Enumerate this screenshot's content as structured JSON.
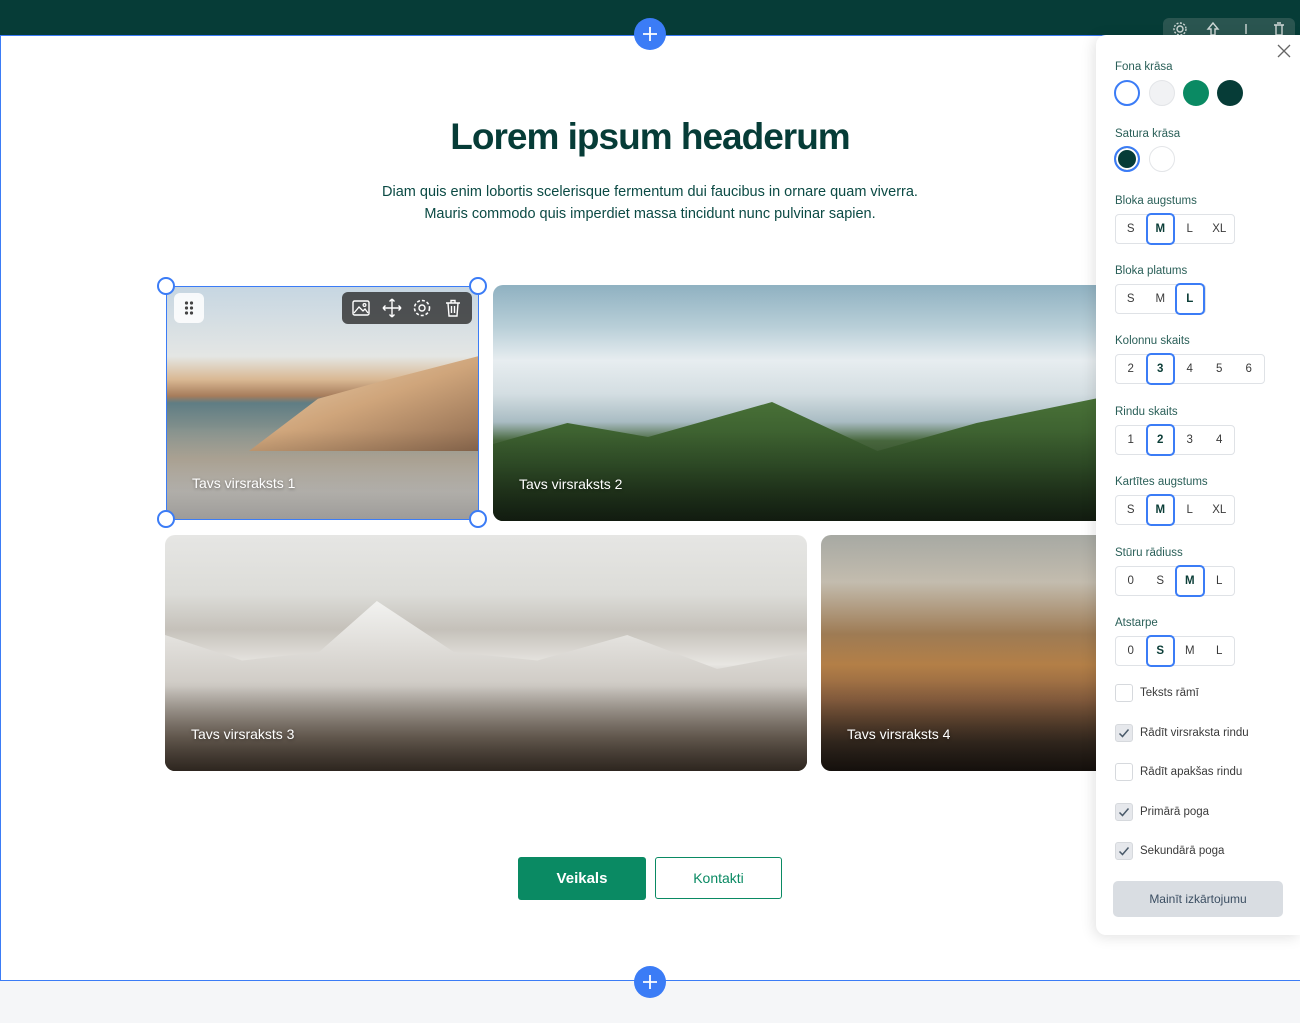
{
  "section": {
    "headline": "Lorem ipsum headerum",
    "lead_line1": "Diam quis enim lobortis scelerisque fermentum dui faucibus in ornare quam viverra.",
    "lead_line2": "Mauris commodo quis imperdiet massa tincidunt nunc pulvinar sapien."
  },
  "cards": [
    {
      "title": "Tavs virsraksts 1"
    },
    {
      "title": "Tavs virsraksts 2"
    },
    {
      "title": "Tavs virsraksts 3"
    },
    {
      "title": "Tavs virsraksts 4"
    }
  ],
  "buttons": {
    "primary": "Veikals",
    "secondary": "Kontakti"
  },
  "icons": {
    "add": "plus-icon",
    "drag": "drag-dots-icon",
    "image": "image-icon",
    "move": "move-icon",
    "settings": "gear-icon",
    "delete": "trash-icon",
    "close": "close-icon",
    "check": "check-icon"
  },
  "colors": {
    "accent": "#3b7cf6",
    "brand_dark": "#063c37",
    "brand_green": "#0a8a63"
  },
  "panel": {
    "bg_color_label": "Fona krāsa",
    "bg_colors": [
      "#ffffff",
      "#f1f2f4",
      "#0a8a63",
      "#063c37"
    ],
    "bg_selected": 0,
    "content_color_label": "Satura krāsa",
    "content_colors": [
      "#063c37",
      "#ffffff"
    ],
    "content_selected": 0,
    "groups": [
      {
        "label": "Bloka augstums",
        "options": [
          "S",
          "M",
          "L",
          "XL"
        ],
        "selected": "M"
      },
      {
        "label": "Bloka platums",
        "options": [
          "S",
          "M",
          "L"
        ],
        "selected": "L"
      },
      {
        "label": "Kolonnu skaits",
        "options": [
          "2",
          "3",
          "4",
          "5",
          "6"
        ],
        "selected": "3"
      },
      {
        "label": "Rindu skaits",
        "options": [
          "1",
          "2",
          "3",
          "4"
        ],
        "selected": "2"
      },
      {
        "label": "Kartītes augstums",
        "options": [
          "S",
          "M",
          "L",
          "XL"
        ],
        "selected": "M"
      },
      {
        "label": "Stūru rādiuss",
        "options": [
          "0",
          "S",
          "M",
          "L"
        ],
        "selected": "M"
      },
      {
        "label": "Atstarpe",
        "options": [
          "0",
          "S",
          "M",
          "L"
        ],
        "selected": "S"
      }
    ],
    "checks": [
      {
        "label": "Teksts rāmī",
        "checked": false
      },
      {
        "label": "Rādīt virsraksta rindu",
        "checked": true
      },
      {
        "label": "Rādīt apakšas rindu",
        "checked": false
      },
      {
        "label": "Primārā poga",
        "checked": true
      },
      {
        "label": "Sekundārā poga",
        "checked": true
      }
    ],
    "change_layout": "Mainīt izkārtojumu"
  }
}
